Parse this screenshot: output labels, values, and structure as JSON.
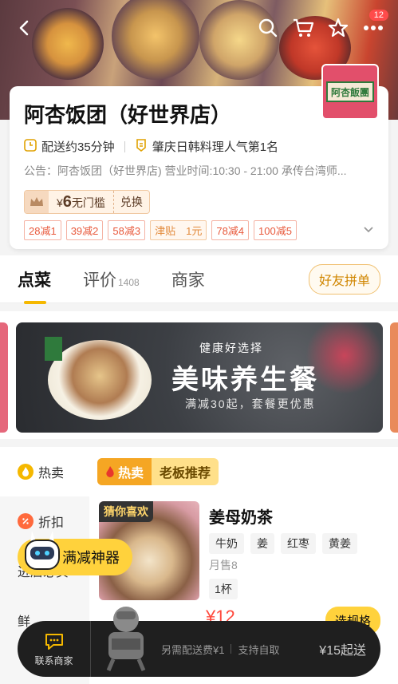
{
  "header": {
    "cart_badge": "12"
  },
  "shop": {
    "name": "阿杏饭团（好世界店）",
    "logo_text": "阿杏飯團",
    "delivery_time": "配送约35分钟",
    "ranking": "肇庆日韩料理人气第1名",
    "notice": "公告：阿杏饭团（好世界店) 营业时间:10:30 - 21:00 承传台湾师...",
    "coupon_currency": "¥",
    "coupon_amount": "6",
    "coupon_desc": "无门槛",
    "coupon_exchange": "兑换",
    "promos": [
      "28减1",
      "39减2",
      "58减3",
      "津贴　1元",
      "78减4",
      "100减5"
    ]
  },
  "tabs": {
    "order": "点菜",
    "reviews": "评价",
    "reviews_count": "1408",
    "merchant": "商家",
    "group_button": "好友拼单"
  },
  "banner": {
    "subtitle": "健康好选择",
    "title": "美味养生餐",
    "desc": "满减30起，套餐更优惠"
  },
  "sidebar": {
    "items": [
      {
        "label": "热卖"
      },
      {
        "label": "折扣"
      },
      {
        "label": "进店必买"
      },
      {
        "label": "鲜"
      }
    ]
  },
  "category": {
    "hot_label": "热卖",
    "rec_label": "老板推荐"
  },
  "dish": {
    "tag": "猜你喜欢",
    "name": "姜母奶茶",
    "options": [
      "牛奶",
      "姜",
      "红枣",
      "黄姜"
    ],
    "sales": "月售8",
    "unit": "1杯",
    "price": "¥12",
    "spec_button": "选规格"
  },
  "mascot": {
    "label": "满减神器"
  },
  "bottom_bar": {
    "contact": "联系商家",
    "delivery_fee": "另需配送费¥1",
    "self_pickup": "支持自取",
    "min_order": "¥15起送"
  }
}
